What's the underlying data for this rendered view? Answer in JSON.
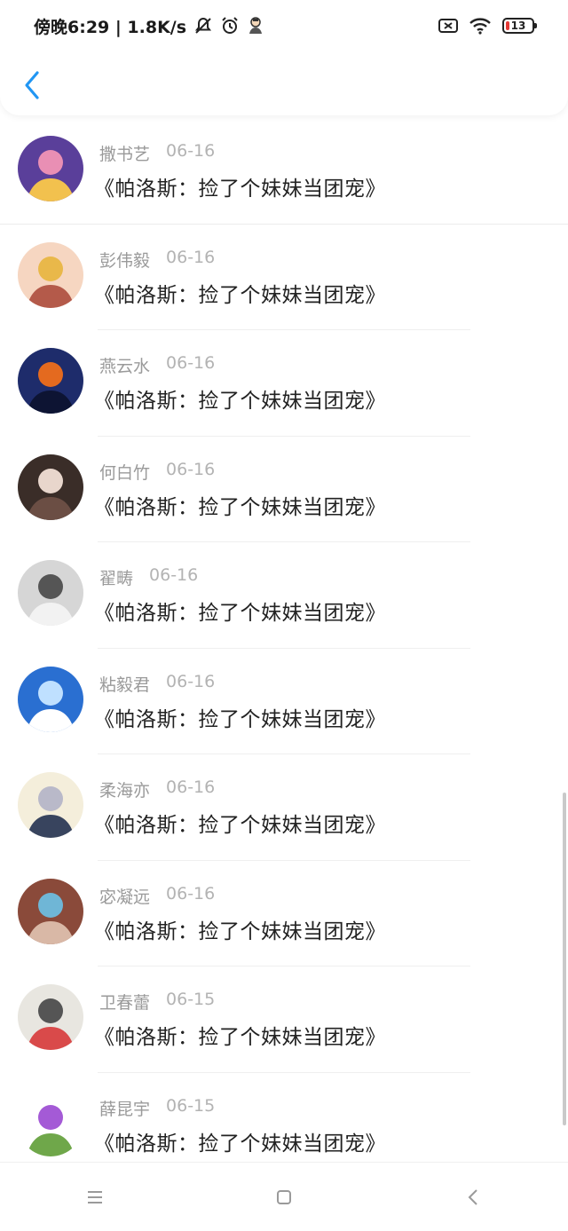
{
  "status_bar": {
    "time_speed": "傍晚6:29 | 1.8K/s",
    "battery_level": "13",
    "icons": [
      "mute-icon",
      "alarm-icon",
      "app-notification-icon",
      "sim-off-icon",
      "wifi-icon",
      "battery-icon"
    ]
  },
  "comments": [
    {
      "name": "撒书艺",
      "date": "06-16",
      "text": "《帕洛斯：捡了个妹妹当团宠》",
      "avatar_colors": [
        "#5a3f9a",
        "#e98fb4",
        "#f2c14e"
      ]
    },
    {
      "name": "彭伟毅",
      "date": "06-16",
      "text": "《帕洛斯：捡了个妹妹当团宠》",
      "avatar_colors": [
        "#f6d6c1",
        "#e9b84a",
        "#b45a4a"
      ]
    },
    {
      "name": "燕云水",
      "date": "06-16",
      "text": "《帕洛斯：捡了个妹妹当团宠》",
      "avatar_colors": [
        "#1e2c6b",
        "#e46a1f",
        "#0d1433"
      ]
    },
    {
      "name": "何白竹",
      "date": "06-16",
      "text": "《帕洛斯：捡了个妹妹当团宠》",
      "avatar_colors": [
        "#3a2d28",
        "#e8d6cc",
        "#6b4e44"
      ]
    },
    {
      "name": "翟畴",
      "date": "06-16",
      "text": "《帕洛斯：捡了个妹妹当团宠》",
      "avatar_colors": [
        "#d6d6d6",
        "#555555",
        "#f2f2f2"
      ]
    },
    {
      "name": "粘毅君",
      "date": "06-16",
      "text": "《帕洛斯：捡了个妹妹当团宠》",
      "avatar_colors": [
        "#2a6fd1",
        "#bfe0ff",
        "#ffffff"
      ]
    },
    {
      "name": "柔海亦",
      "date": "06-16",
      "text": "《帕洛斯：捡了个妹妹当团宠》",
      "avatar_colors": [
        "#f4eedb",
        "#b9b9c9",
        "#38445e"
      ]
    },
    {
      "name": "宓凝远",
      "date": "06-16",
      "text": "《帕洛斯：捡了个妹妹当团宠》",
      "avatar_colors": [
        "#8a4a3a",
        "#6fb6d6",
        "#d9b8a6"
      ]
    },
    {
      "name": "卫春蕾",
      "date": "06-15",
      "text": "《帕洛斯：捡了个妹妹当团宠》",
      "avatar_colors": [
        "#e8e6e0",
        "#555555",
        "#d94a4a"
      ]
    },
    {
      "name": "薛昆宇",
      "date": "06-15",
      "text": "《帕洛斯：捡了个妹妹当团宠》",
      "avatar_colors": [
        "#ffffff",
        "#a45ad6",
        "#6fa74a"
      ]
    }
  ],
  "accent_color": "#2196f3"
}
